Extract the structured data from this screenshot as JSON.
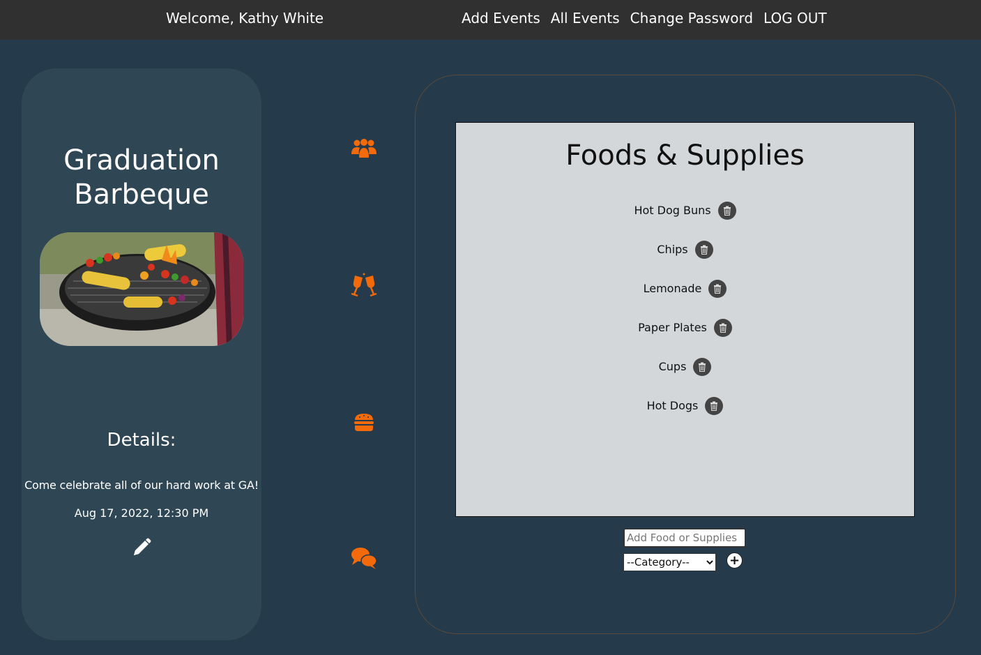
{
  "nav": {
    "welcome": "Welcome, Kathy White",
    "links": [
      "Add Events",
      "All Events",
      "Change Password",
      "LOG OUT"
    ]
  },
  "event": {
    "title": "Graduation Barbeque",
    "photo_icon": "bbq-grill-photo",
    "details_heading": "Details:",
    "description": "Come celebrate all of our hard work at GA!",
    "date": "Aug 17, 2022, 12:30 PM",
    "edit_icon": "pencil-icon"
  },
  "side_icons": [
    "people-group-icon",
    "champagne-glasses-icon",
    "burger-icon",
    "comments-icon"
  ],
  "foods": {
    "title": "Foods & Supplies",
    "items": [
      "Hot Dog Buns",
      "Chips",
      "Lemonade",
      "Paper Plates",
      "Cups",
      "Hot Dogs"
    ],
    "input_placeholder": "Add Food or Supplies",
    "category_selected": "--Category--",
    "add_label": "+"
  },
  "colors": {
    "background": "#253a4a",
    "topbar": "#303030",
    "card": "#2f4654",
    "accent": "#f26a0a",
    "list_bg": "#d3d7da"
  }
}
